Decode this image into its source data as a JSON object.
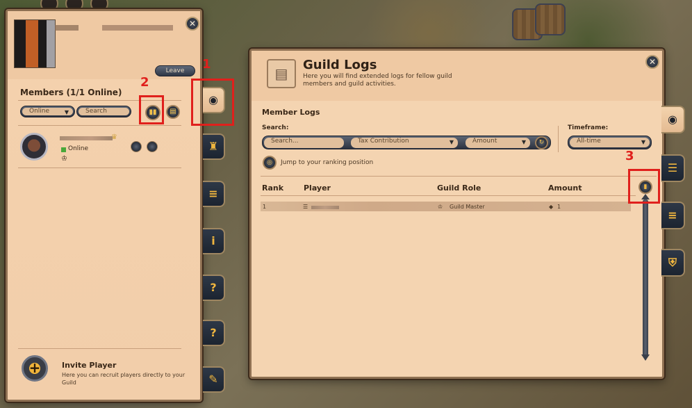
{
  "guild_panel": {
    "leave_label": "Leave",
    "close_label": "✕",
    "members_title": "Members (1/1 Online)",
    "filter_select": "Online",
    "search_placeholder": "Search",
    "member": {
      "status": "Online"
    },
    "invite": {
      "title": "Invite Player",
      "description": "Here you can recruit players directly to your Guild",
      "icon_glyph": "+"
    }
  },
  "logs_panel": {
    "title": "Guild Logs",
    "description": "Here you will find extended logs for fellow guild members and guild activities.",
    "close_label": "✕",
    "section_title": "Member Logs",
    "search_label": "Search:",
    "search_placeholder": "Search...",
    "type_select": "Tax Contribution",
    "sort_select": "Amount",
    "timeframe_label": "Timeframe:",
    "timeframe_select": "All-time",
    "jump_text": "Jump to your ranking position",
    "columns": [
      "Rank",
      "Player",
      "Guild Role",
      "Amount"
    ],
    "rows": [
      {
        "rank": "1",
        "guild_role": "Guild Master",
        "amount": "1"
      }
    ]
  },
  "annotations": [
    "1",
    "2",
    "3"
  ],
  "colors": {
    "panel_bg": "#f4d4b1",
    "panel_border": "#8e7052",
    "accent_gold": "#f0b63f",
    "highlight_red": "#e0201c",
    "online_green": "#49a83a"
  },
  "icons": {
    "guild_logs_tab": "guild-logs-icon",
    "castle_tab": "castle-icon",
    "coins_tab": "coins-icon",
    "info_tab": "info-icon",
    "question_tab": "question-icon",
    "edit_tab": "edit-icon"
  }
}
